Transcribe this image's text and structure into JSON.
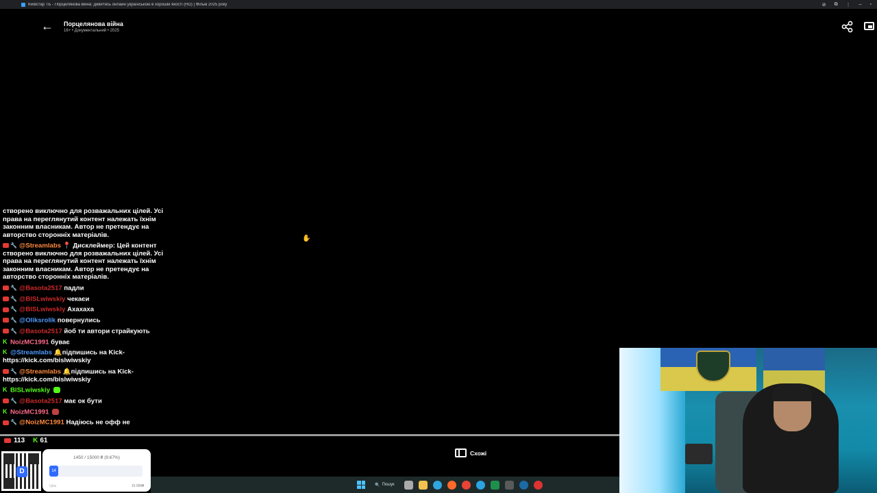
{
  "window": {
    "title": "Київстар ТБ - Порцелянова війна: дивитись онлайн українською в хорошій якості (HD) | Фільм 2025 року"
  },
  "player": {
    "title": "Порцелянова війна",
    "meta": "16+ • Документальний • 2025",
    "similar_label": "Схожі"
  },
  "chat": {
    "top_text": "створено виключно для розважальних цілей. Усі права на переглянутий контент належать їхнім законним власникам. Автор не претендує на авторство сторонніх матеріалів.",
    "messages": [
      {
        "platform": "youtube",
        "user": "@Streamlabs",
        "user_color": "orange",
        "text": "📍 Дисклеймер: Цей контент створено виключно для розважальних цілей. Усі права на переглянутий контент належать їхнім законним власникам. Автор не претендує на авторство сторонніх матеріалів."
      },
      {
        "platform": "youtube",
        "user": "@Basota2517",
        "user_color": "red",
        "text": "падли"
      },
      {
        "platform": "youtube",
        "user": "@BlSLwiwskiy",
        "user_color": "red",
        "text": "чекаєи"
      },
      {
        "platform": "youtube",
        "user": "@BlSLwiwskiy",
        "user_color": "red",
        "text": "Ахахаха"
      },
      {
        "platform": "youtube",
        "user": "@Oliksrolik",
        "user_color": "blue",
        "text": "повернулись"
      },
      {
        "platform": "youtube",
        "user": "@Basota2517",
        "user_color": "red",
        "text": "йоб ти автори страйкують"
      },
      {
        "platform": "kick",
        "user": "NoizMC1991",
        "user_color": "pink",
        "text": "буває"
      },
      {
        "platform": "kick",
        "user": "@Streamlabs",
        "user_color": "blue",
        "text": "🔔підпишись на Kick- https://kick.com/bislwiwskiy"
      },
      {
        "platform": "youtube",
        "user": "@Streamlabs",
        "user_color": "orange",
        "text": "🔔підпишись на Kick- https://kick.com/bislwiwskiy"
      },
      {
        "platform": "kick",
        "user": "BlSLwiwskiy",
        "user_color": "green",
        "text": ""
      },
      {
        "platform": "youtube",
        "user": "@Basota2517",
        "user_color": "red",
        "text": "має ок бути"
      },
      {
        "platform": "kick",
        "user": "NoizMC1991",
        "user_color": "pink",
        "text": ""
      },
      {
        "platform": "youtube",
        "user": "@NoizMC1991",
        "user_color": "orange",
        "text": "Надіюсь не офф не"
      }
    ]
  },
  "viewers": {
    "youtube": "113",
    "kick": "61"
  },
  "playback": {
    "progress_fraction": 1.0
  },
  "donation": {
    "progress_text": "1450 / 15000 ₴ (9.67%)",
    "fill_label": "14",
    "fraction": 0.0967,
    "goal_left": "Ціль",
    "goal_right": "15 000₴"
  },
  "qr": {
    "logo": "D"
  },
  "taskbar": {
    "search_label": "Пошук",
    "icons": [
      "windows-icon",
      "search-icon",
      "task-view-icon",
      "file-explorer-icon",
      "edge-icon",
      "firefox-icon",
      "chrome-icon",
      "telegram-icon",
      "excel-icon",
      "terminal-icon",
      "steam-icon",
      "obs-icon"
    ]
  },
  "colors": {
    "youtube": "#e53935",
    "kick": "#53fc18",
    "accent": "#2f6bff"
  }
}
